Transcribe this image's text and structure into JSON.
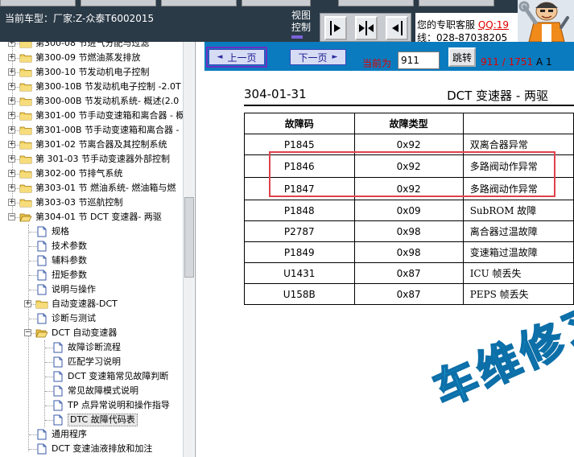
{
  "header": {
    "vehicle": "当前车型：厂家:Z-众泰T6002015",
    "view_control": [
      "视图",
      "控制"
    ],
    "contact_line1": "您的专职客服",
    "contact_qq": "QQ:19",
    "contact_line2": "线：028-87038205"
  },
  "tree": [
    {
      "label": "第300-08 节进气分配与过滤",
      "kind": "folder",
      "toggle": "+"
    },
    {
      "label": "第300-09 节燃油蒸发排放",
      "kind": "folder",
      "toggle": "+"
    },
    {
      "label": "第300-10 节发动机电子控制",
      "kind": "folder",
      "toggle": "+"
    },
    {
      "label": "第300-10B 节发动机电子控制 -2.0T",
      "kind": "folder",
      "toggle": "+"
    },
    {
      "label": "第300-00B 节发动机系统- 概述(2.0",
      "kind": "folder",
      "toggle": "+"
    },
    {
      "label": "第301-00 节手动变速箱和离合器 - 概",
      "kind": "folder",
      "toggle": "+"
    },
    {
      "label": "第301-00B 节手动变速箱和离合器 -",
      "kind": "folder",
      "toggle": "+"
    },
    {
      "label": "第301-02 节离合器及其控制系统",
      "kind": "folder",
      "toggle": "+"
    },
    {
      "label": "第 301-03 节手动变速器外部控制",
      "kind": "folder",
      "toggle": "+"
    },
    {
      "label": "第302-00 节排气系统",
      "kind": "folder",
      "toggle": "+"
    },
    {
      "label": "第303-01 节 燃油系统- 燃油箱与燃",
      "kind": "folder",
      "toggle": "+"
    },
    {
      "label": "第303-03 节巡航控制",
      "kind": "folder",
      "toggle": "+"
    },
    {
      "label": "第304-01 节 DCT 变速器- 两驱",
      "kind": "folder-open",
      "toggle": "−"
    },
    {
      "label": "规格",
      "kind": "doc"
    },
    {
      "label": "技术参数",
      "kind": "doc"
    },
    {
      "label": "辅料参数",
      "kind": "doc"
    },
    {
      "label": "扭矩参数",
      "kind": "doc"
    },
    {
      "label": "说明与操作",
      "kind": "doc"
    },
    {
      "label": "自动变速器-DCT",
      "kind": "folder",
      "toggle": "+"
    },
    {
      "label": "诊断与测试",
      "kind": "doc"
    },
    {
      "label": "DCT 自动变速器",
      "kind": "folder-open",
      "toggle": "−"
    },
    {
      "label": "故障诊断流程",
      "kind": "doc"
    },
    {
      "label": "匹配学习说明",
      "kind": "doc"
    },
    {
      "label": "DCT 变速箱常见故障判断",
      "kind": "doc"
    },
    {
      "label": "常见故障模式说明",
      "kind": "doc"
    },
    {
      "label": "TP 点异常说明和操作指导",
      "kind": "doc"
    },
    {
      "label": "DTC 故障代码表",
      "kind": "doc",
      "selected": true
    },
    {
      "label": "通用程序",
      "kind": "doc"
    },
    {
      "label": "DCT 变速油液排放和加注",
      "kind": "doc"
    }
  ],
  "nav": {
    "prev": "上一页",
    "next": "下一页",
    "current_label": "当前为",
    "page_value": "911",
    "jump": "跳转",
    "page_count": "911 / 1751",
    "page_suffix": "A 1"
  },
  "document": {
    "code": "304-01-31",
    "title": "DCT 变速器 - 两驱",
    "columns": [
      "故障码",
      "故障类型",
      ""
    ],
    "rows": [
      [
        "P1845",
        "0x92",
        "双离合器异常"
      ],
      [
        "P1846",
        "0x92",
        "多路阀动作异常"
      ],
      [
        "P1847",
        "0x92",
        "多路阀动作异常"
      ],
      [
        "P1848",
        "0x09",
        "SubROM 故障"
      ],
      [
        "P2787",
        "0x98",
        "离合器过温故障"
      ],
      [
        "P1849",
        "0x98",
        "变速箱过温故障"
      ],
      [
        "U1431",
        "0x87",
        "ICU 帧丢失"
      ],
      [
        "U158B",
        "0x87",
        "PEPS 帧丢失"
      ]
    ],
    "watermark": "车维修习"
  },
  "colors": {
    "header_bg": "#2b3a47",
    "nav_bg": "#0a7bbf",
    "highlight": "#e0424a",
    "accent_red": "#e00000",
    "watermark": "#1fa8e0"
  }
}
